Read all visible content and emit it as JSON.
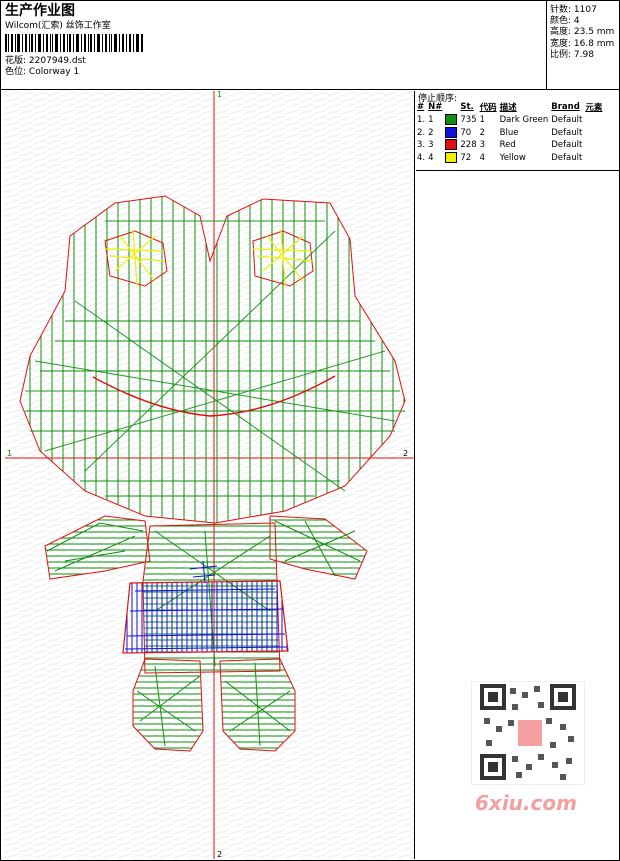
{
  "header": {
    "title": "生产作业图",
    "studio": "Wilcom(汇索) 丝饰工作室",
    "design_label": "花版:",
    "design_value": "2207949.dst",
    "colorway_label": "色位:",
    "colorway_value": "Colorway 1"
  },
  "stats": {
    "stitches": "针数: 1107",
    "colors": "颜色: 4",
    "height": "高度: 23.5 mm",
    "width": "宽度: 16.8 mm",
    "scale": "比例: 7.98"
  },
  "stop_sequence": {
    "caption": "停止顺序:",
    "headers": [
      "#",
      "N#",
      "St.",
      "代码",
      "描述",
      "Brand",
      "元素"
    ],
    "rows": [
      {
        "idx": "1.",
        "n": "1",
        "color": "#0f8f0f",
        "st": "735",
        "code": "1",
        "desc": "Dark Green",
        "brand": "Default"
      },
      {
        "idx": "2.",
        "n": "2",
        "color": "#1010e0",
        "st": "70",
        "code": "2",
        "desc": "Blue",
        "brand": "Default"
      },
      {
        "idx": "3.",
        "n": "3",
        "color": "#e01010",
        "st": "228",
        "code": "3",
        "desc": "Red",
        "brand": "Default"
      },
      {
        "idx": "4.",
        "n": "4",
        "color": "#f2ee00",
        "st": "72",
        "code": "4",
        "desc": "Yellow",
        "brand": "Default"
      }
    ]
  },
  "axes": {
    "top": "1",
    "bottom": "2",
    "left": "1",
    "right": "2"
  },
  "watermark": {
    "site": "6xiu.com"
  },
  "colors": {
    "green": "#0f8f0f",
    "blue": "#1010e0",
    "red": "#e01010",
    "yellow": "#f2ee00"
  }
}
